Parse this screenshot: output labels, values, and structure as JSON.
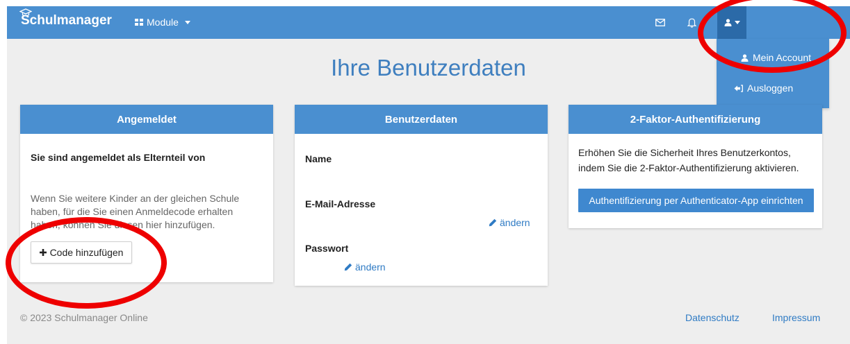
{
  "navbar": {
    "brand": "Schulmanager",
    "modules_label": "Module"
  },
  "user_menu": {
    "items": [
      {
        "label": "Mein Account",
        "icon": "user-icon"
      },
      {
        "label": "Ausloggen",
        "icon": "logout-icon"
      }
    ]
  },
  "page": {
    "title": "Ihre Benutzerdaten"
  },
  "cards": {
    "logged_in": {
      "header": "Angemeldet",
      "heading": "Sie sind angemeldet als Elternteil von",
      "line1": "Wenn Sie weitere Kinder an der gleichen Schule",
      "line2": "haben, für die Sie einen Anmeldecode erhalten",
      "line3": "haben, können Sie diesen hier hinzufügen.",
      "button": "Code hinzufügen"
    },
    "user_data": {
      "header": "Benutzerdaten",
      "name_label": "Name",
      "email_label": "E-Mail-Adresse",
      "email_change": "ändern",
      "password_label": "Passwort",
      "password_change": "ändern"
    },
    "two_factor": {
      "header": "2-Faktor-Authentifizierung",
      "line1": "Erhöhen Sie die Sicherheit Ihres Benutzerkontos,",
      "line2": "indem Sie die 2-Faktor-Authentifizierung aktivieren.",
      "button": "Authentifizierung per Authenticator-App einrichten"
    }
  },
  "footer": {
    "copyright": "© 2023 Schulmanager Online",
    "privacy": "Datenschutz",
    "imprint": "Impressum"
  },
  "colors": {
    "navbar": "#4a8fd0",
    "accent_dark": "#2b6aa8",
    "title": "#3f7fbf",
    "annotation": "#ee0000"
  }
}
